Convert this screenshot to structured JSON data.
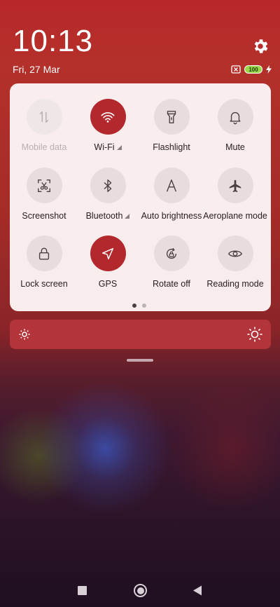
{
  "status": {
    "time": "10:13",
    "date": "Fri, 27 Mar",
    "battery_level": "100"
  },
  "tiles": [
    {
      "label": "Mobile data",
      "icon": "mobile-data-icon",
      "state": "disabled",
      "signal": false
    },
    {
      "label": "Wi-Fi",
      "icon": "wifi-icon",
      "state": "active",
      "signal": true
    },
    {
      "label": "Flashlight",
      "icon": "flashlight-icon",
      "state": "inactive",
      "signal": false
    },
    {
      "label": "Mute",
      "icon": "bell-icon",
      "state": "inactive",
      "signal": false
    },
    {
      "label": "Screenshot",
      "icon": "screenshot-scissors-icon",
      "state": "inactive",
      "signal": false
    },
    {
      "label": "Bluetooth",
      "icon": "bluetooth-icon",
      "state": "inactive",
      "signal": true
    },
    {
      "label": "Auto brightness",
      "icon": "auto-brightness-icon",
      "state": "inactive",
      "signal": false
    },
    {
      "label": "Aeroplane mode",
      "icon": "airplane-icon",
      "state": "inactive",
      "signal": false
    },
    {
      "label": "Lock screen",
      "icon": "lock-icon",
      "state": "inactive",
      "signal": false
    },
    {
      "label": "GPS",
      "icon": "gps-arrow-icon",
      "state": "active",
      "signal": false
    },
    {
      "label": "Rotate off",
      "icon": "rotate-lock-icon",
      "state": "inactive",
      "signal": false
    },
    {
      "label": "Reading mode",
      "icon": "eye-icon",
      "state": "inactive",
      "signal": false
    }
  ],
  "pager": {
    "pages": 2,
    "current": 1
  },
  "brightness": {
    "level": 1.0
  },
  "colors": {
    "accent": "#b3282d",
    "tile_bg": "#e8dcdc",
    "panel_bg": "#fcf6f6"
  }
}
